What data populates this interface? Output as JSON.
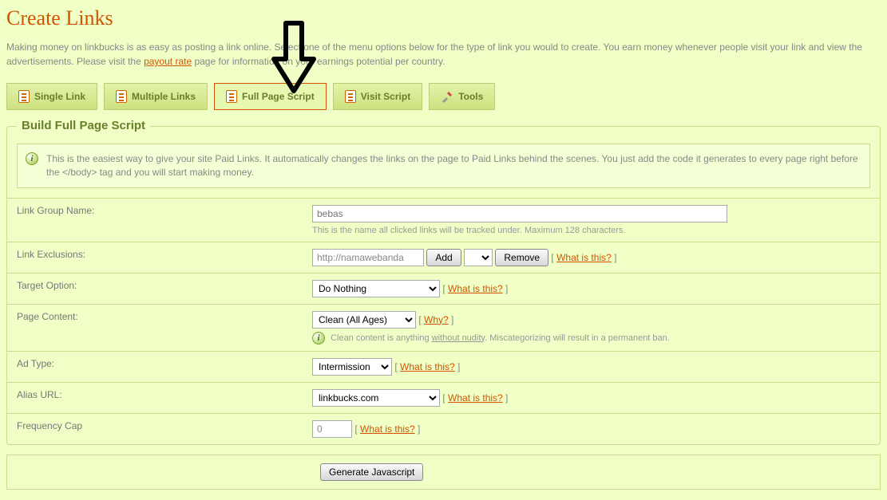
{
  "page_title": "Create Links",
  "intro_before_link": "Making money on linkbucks is as easy as posting a link online. Select one of the menu options below for the type of link you would to create. You earn money whenever people visit your link and view the advertisements. Please visit the ",
  "intro_link_text": "payout rate",
  "intro_after_link": " page for information on your earnings potential per country.",
  "tabs": {
    "single": "Single Link",
    "multiple": "Multiple Links",
    "fullpage": "Full Page Script",
    "visit": "Visit Script",
    "tools": "Tools"
  },
  "legend": "Build Full Page Script",
  "info_text": "This is the easiest way to give your site Paid Links. It automatically changes the links on the page to Paid Links behind the scenes. You just add the code it generates to every page right before the </body> tag and you will start making money.",
  "labels": {
    "group": "Link Group Name:",
    "exclusions": "Link Exclusions:",
    "target": "Target Option:",
    "content": "Page Content:",
    "adtype": "Ad Type:",
    "alias": "Alias URL:",
    "freq": "Frequency Cap"
  },
  "fields": {
    "group_placeholder": "bebas",
    "group_hint": "This is the name all clicked links will be tracked under. Maximum 128 characters.",
    "excl_value": "http://namawebanda",
    "btn_add": "Add",
    "btn_remove": "Remove",
    "what_is_this": "What is this?",
    "target_value": "Do Nothing",
    "content_value": "Clean (All Ages)",
    "why": "Why?",
    "content_hint_prefix": "Clean content is anything ",
    "content_hint_underline": "without nudity",
    "content_hint_suffix": ". Miscategorizing will result in a permanent ban.",
    "adtype_value": "Intermission",
    "alias_value": "linkbucks.com",
    "freq_value": "0",
    "generate": "Generate Javascript"
  }
}
